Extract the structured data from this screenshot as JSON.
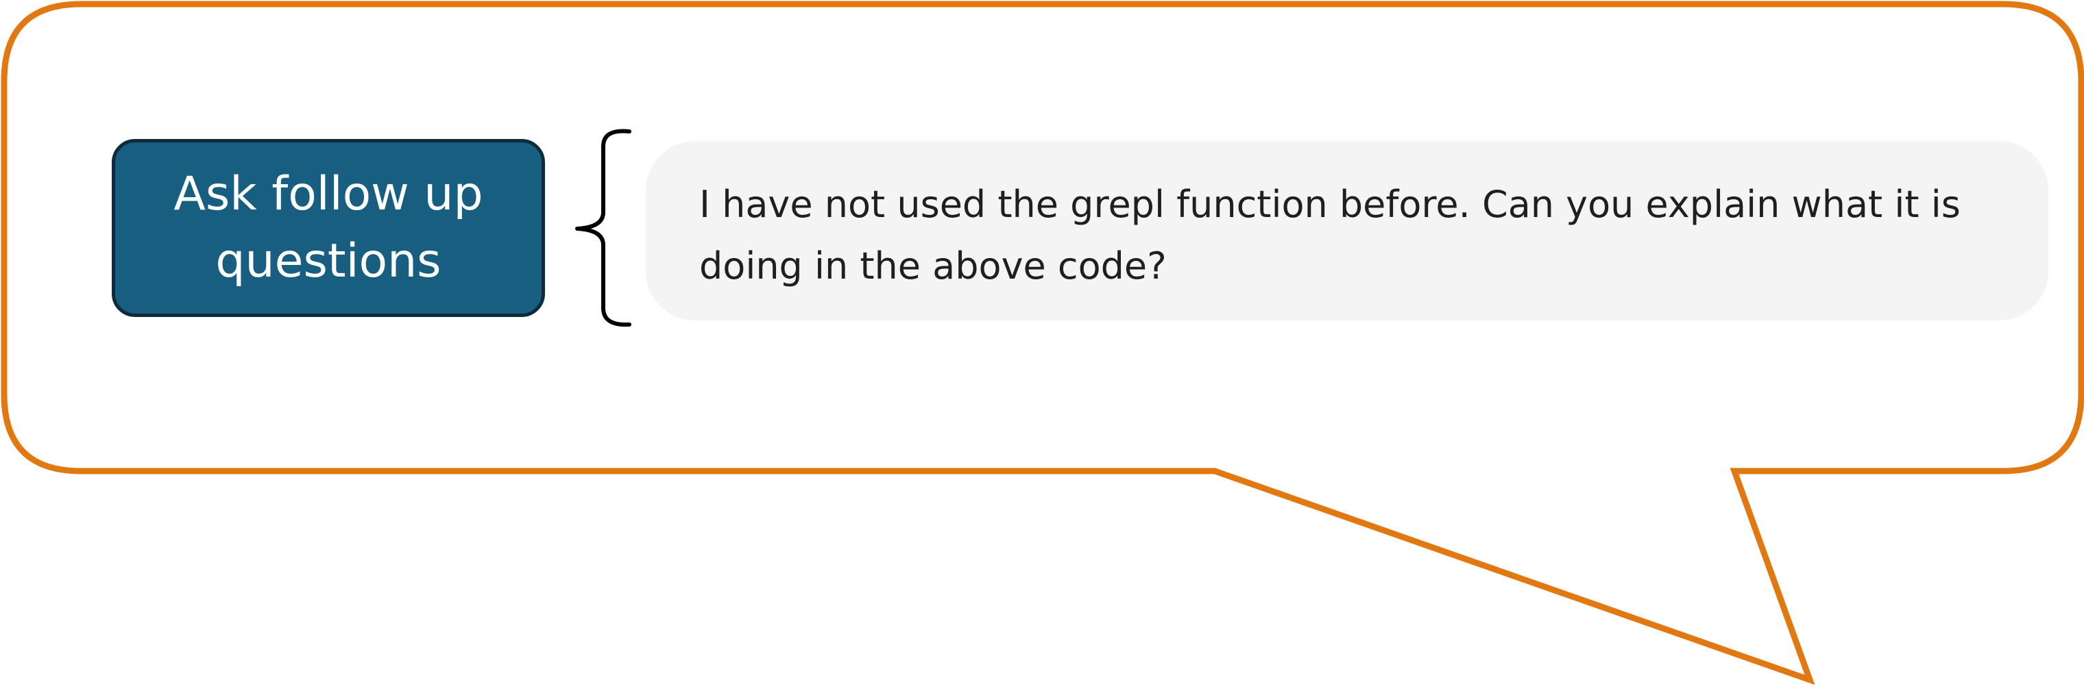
{
  "label": {
    "text": "Ask follow up questions"
  },
  "prompt": {
    "text": "I have not used the grepl function before. Can you explain what it is doing in the above code?"
  },
  "colors": {
    "callout_border": "#e27811",
    "label_fill": "#175e80",
    "label_border": "#0f2a3a",
    "label_text": "#ffffff",
    "bubble_fill": "#f4f4f4",
    "bubble_text": "#1f1f1f",
    "brace": "#000000"
  }
}
